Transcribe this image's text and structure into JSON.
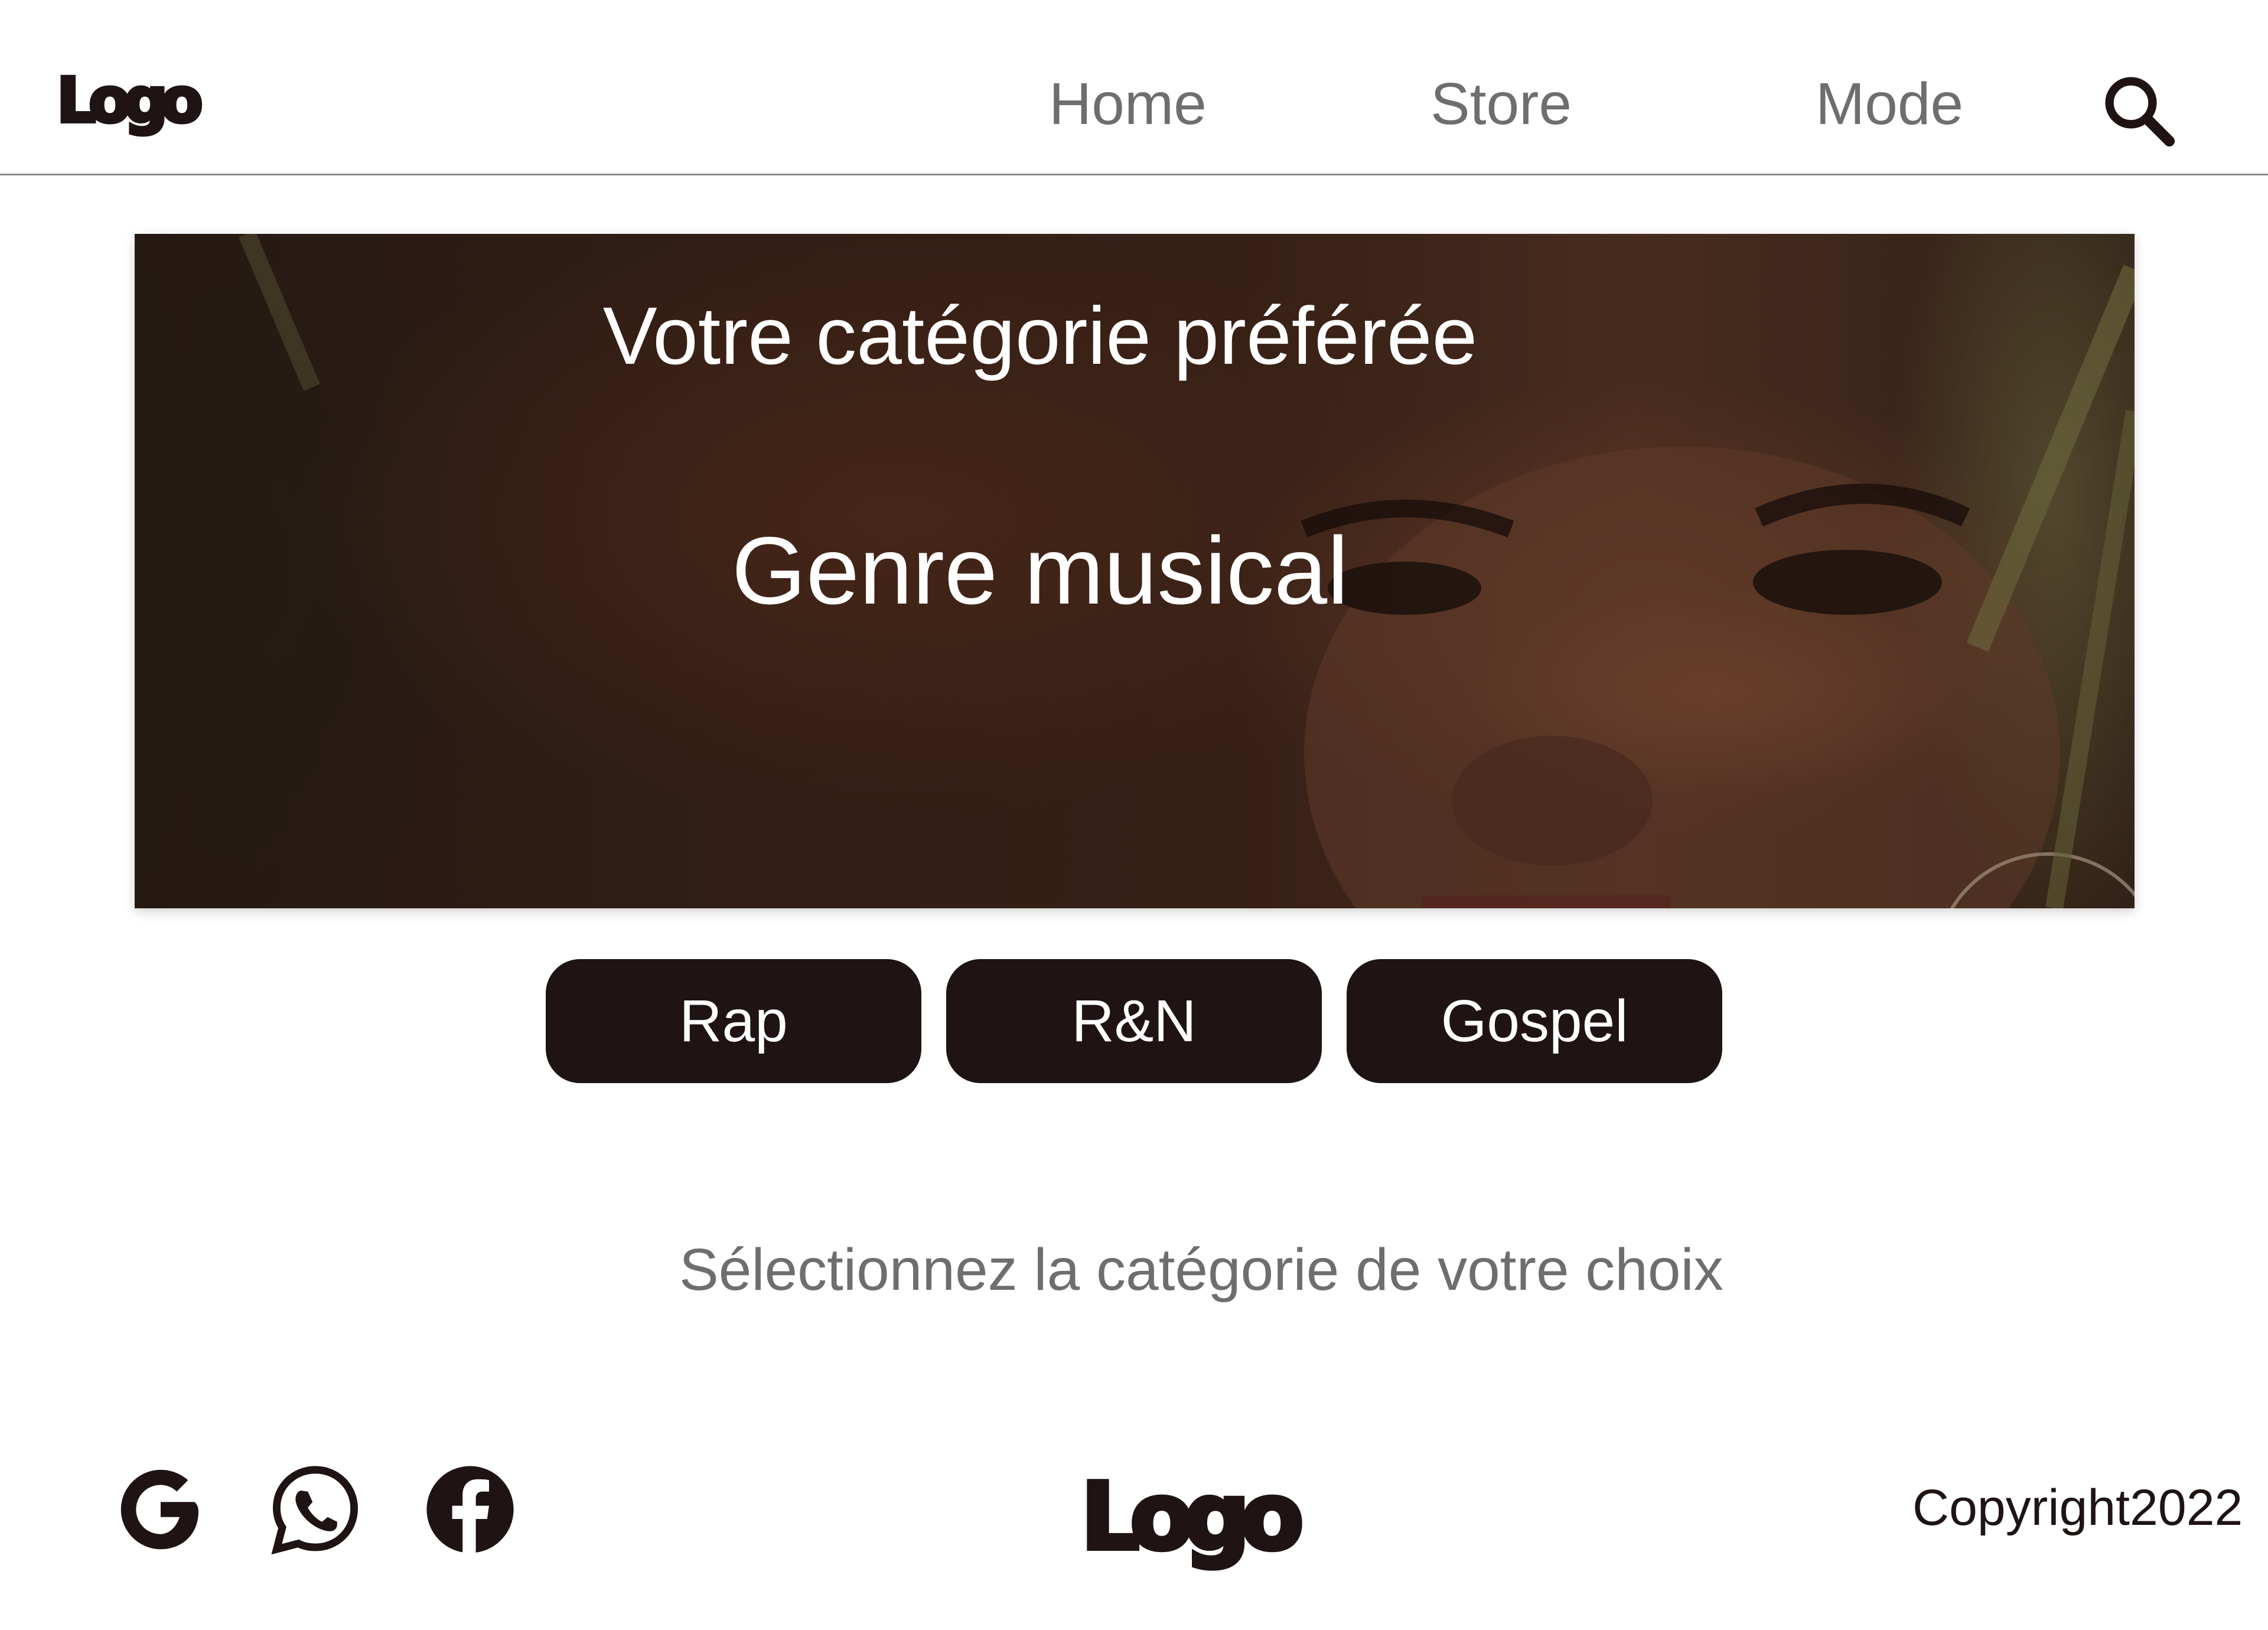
{
  "header": {
    "logo": "Logo",
    "nav": [
      {
        "label": "Home"
      },
      {
        "label": "Store"
      },
      {
        "label": "Mode"
      }
    ],
    "search_icon": "search-icon"
  },
  "hero": {
    "title": "Votre catégorie préférée",
    "subtitle": "Genre musical"
  },
  "genres": [
    {
      "label": "Rap"
    },
    {
      "label": "R&N"
    },
    {
      "label": "Gospel"
    }
  ],
  "helper_text": "Sélectionnez la catégorie de votre choix",
  "footer": {
    "social": [
      "google-icon",
      "whatsapp-icon",
      "facebook-icon"
    ],
    "logo": "Logo",
    "copyright": "Copyright2022"
  },
  "colors": {
    "primary": "#1f1314",
    "nav_text": "#6e6e6e",
    "background": "#ffffff"
  }
}
